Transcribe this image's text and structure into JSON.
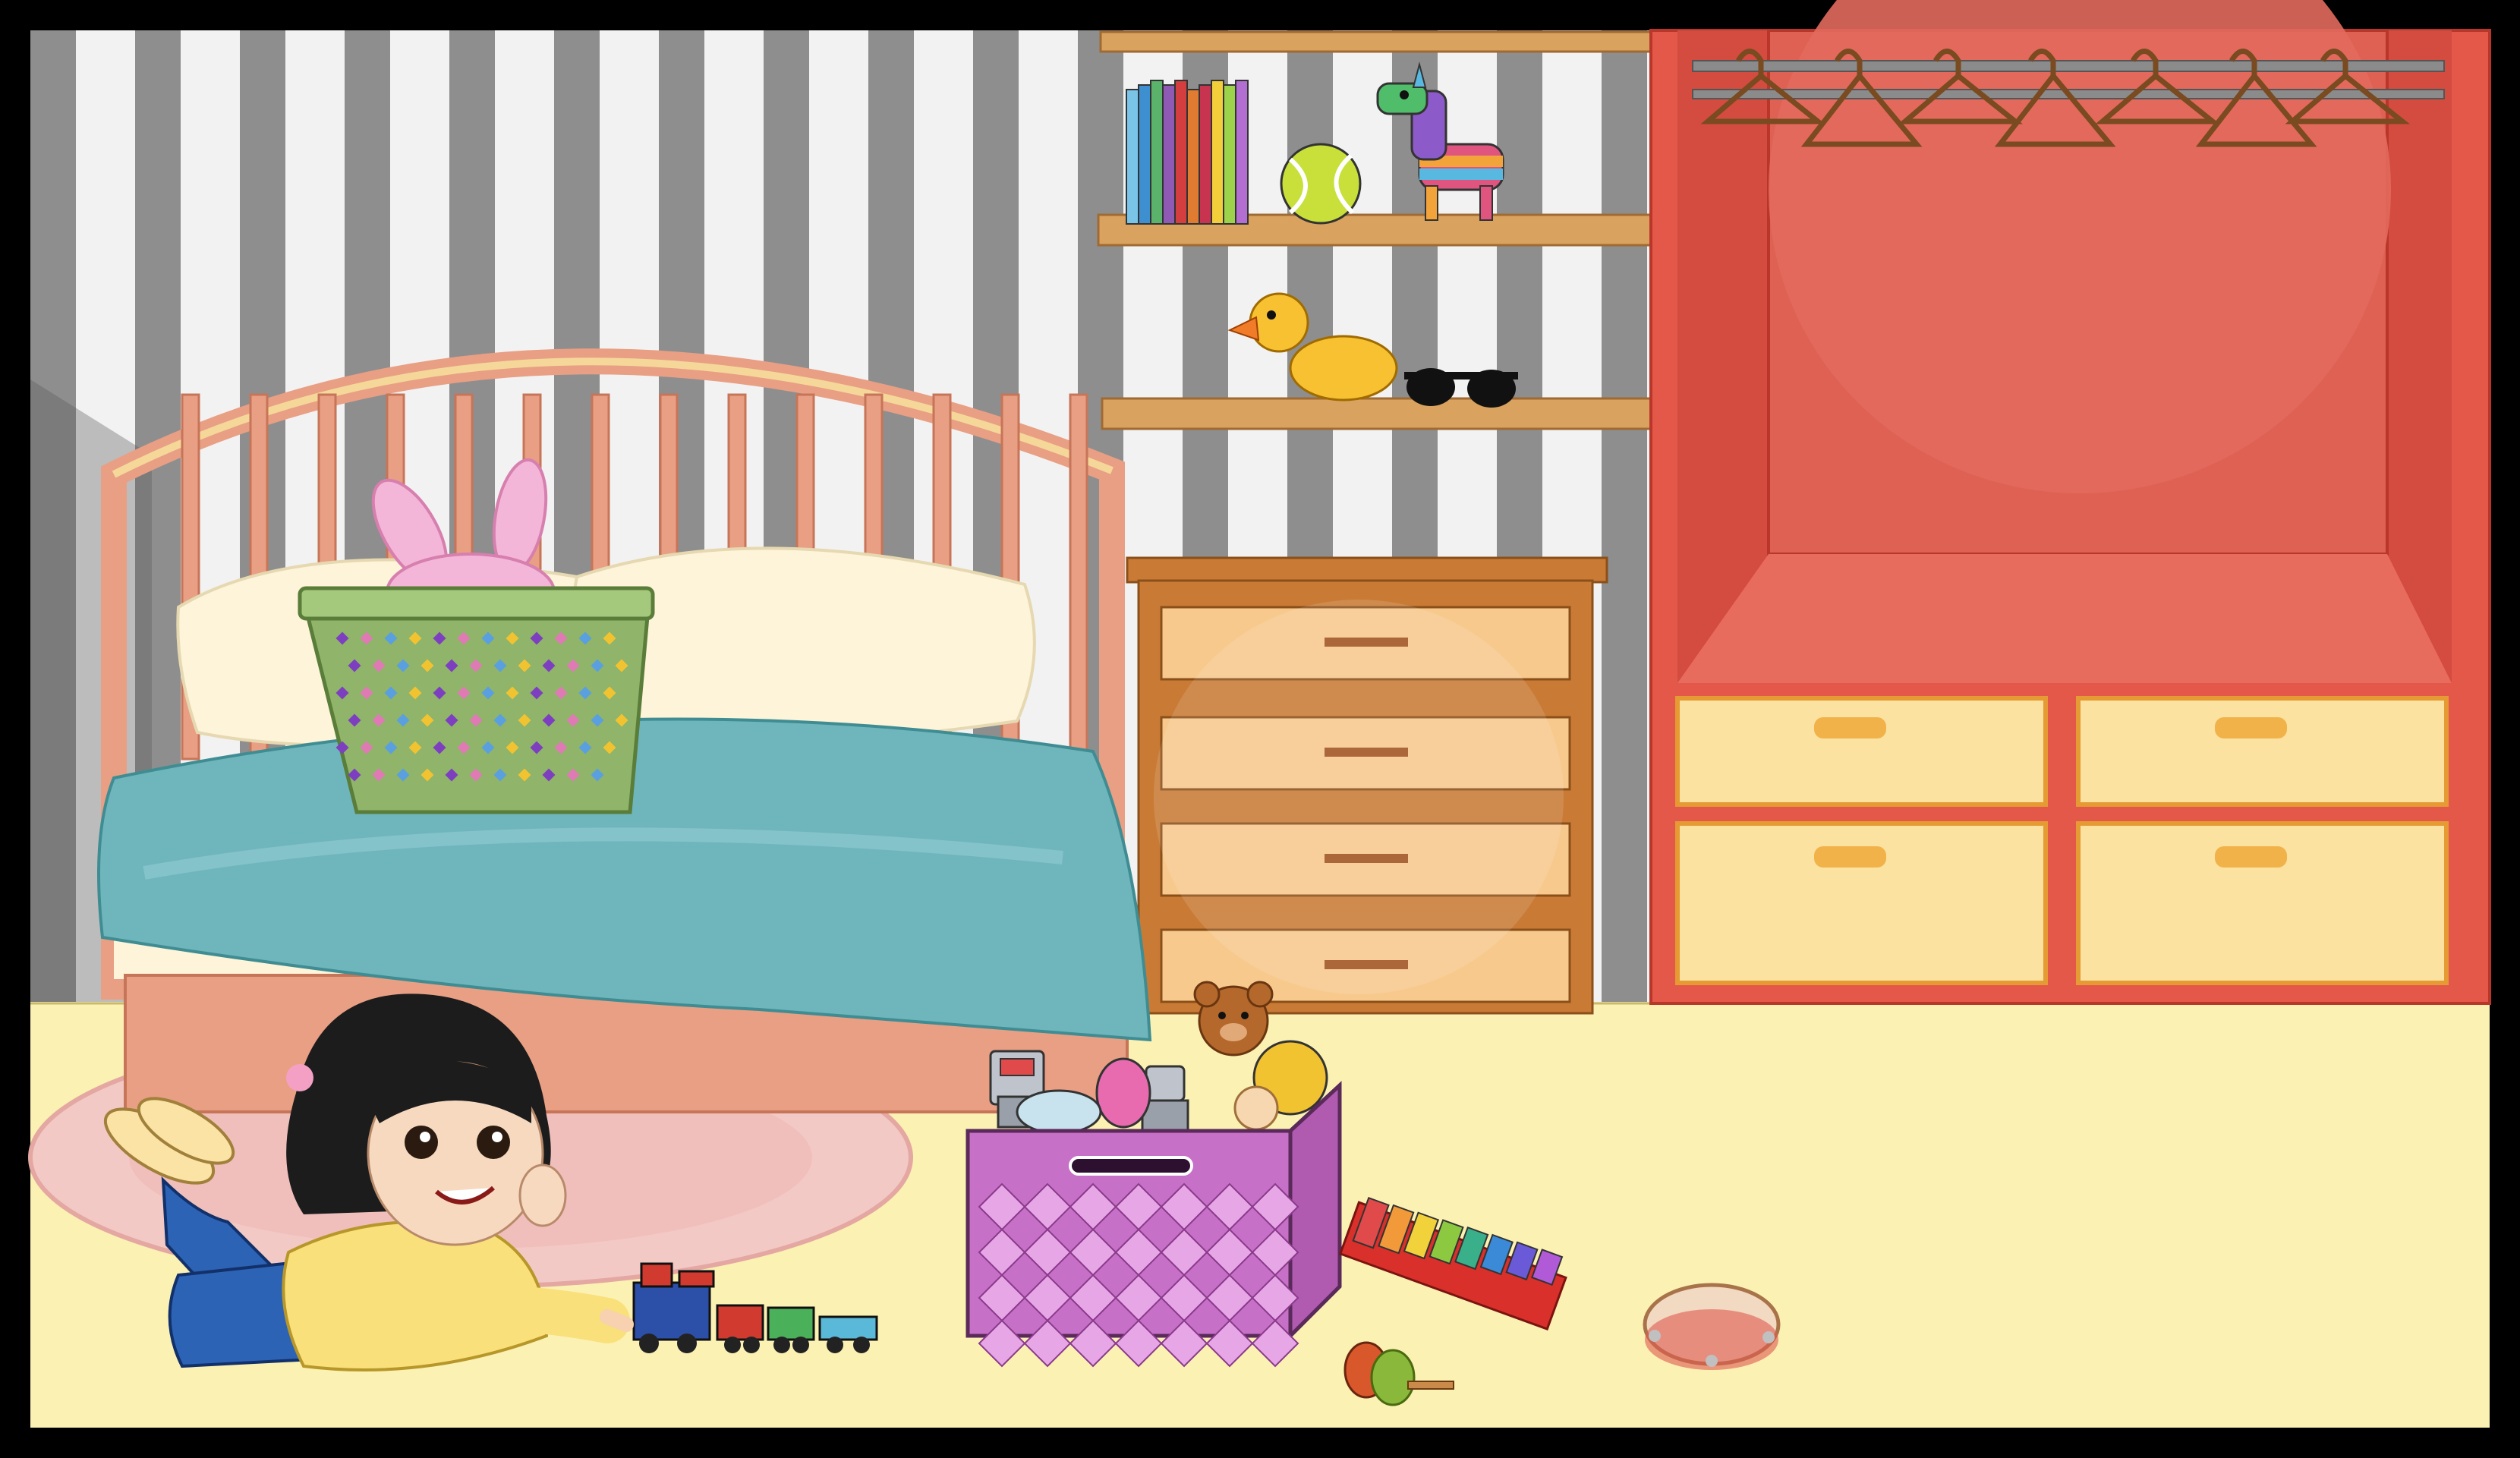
{
  "scene": {
    "palette": {
      "frame": "#000000",
      "wall_light": "#f2f2f2",
      "wall_stripe": "#8e8e8e",
      "floor": "#fbf1b3",
      "rug": "#f2c9c5",
      "bed_frame": "#e89f84",
      "blanket": "#6fb6bc",
      "pillow": "#fdf4d9",
      "basket": "#8fb46a",
      "dresser": "#c97b36",
      "drawer": "#f7c98c",
      "shelf": "#d9a25f",
      "wardrobe": "#e4584a",
      "wardrobe_inner": "#de6154",
      "wardrobe_drawer": "#fbe2a0",
      "toy_box": "#d98ad9",
      "girl_shirt": "#f9e07a",
      "girl_jeans": "#2d63b5",
      "girl_hair": "#1c1c1c"
    },
    "objects": [
      "bed",
      "laundry-basket",
      "bunny-plush",
      "dresser",
      "wall-shelves",
      "books",
      "tennis-ball",
      "pinata",
      "rubber-duck",
      "sunglasses",
      "wardrobe",
      "clothes-hangers",
      "girl",
      "toy-train",
      "toy-box",
      "teddy-bear",
      "robot-toys",
      "xylophone",
      "maracas",
      "tambourine"
    ]
  }
}
